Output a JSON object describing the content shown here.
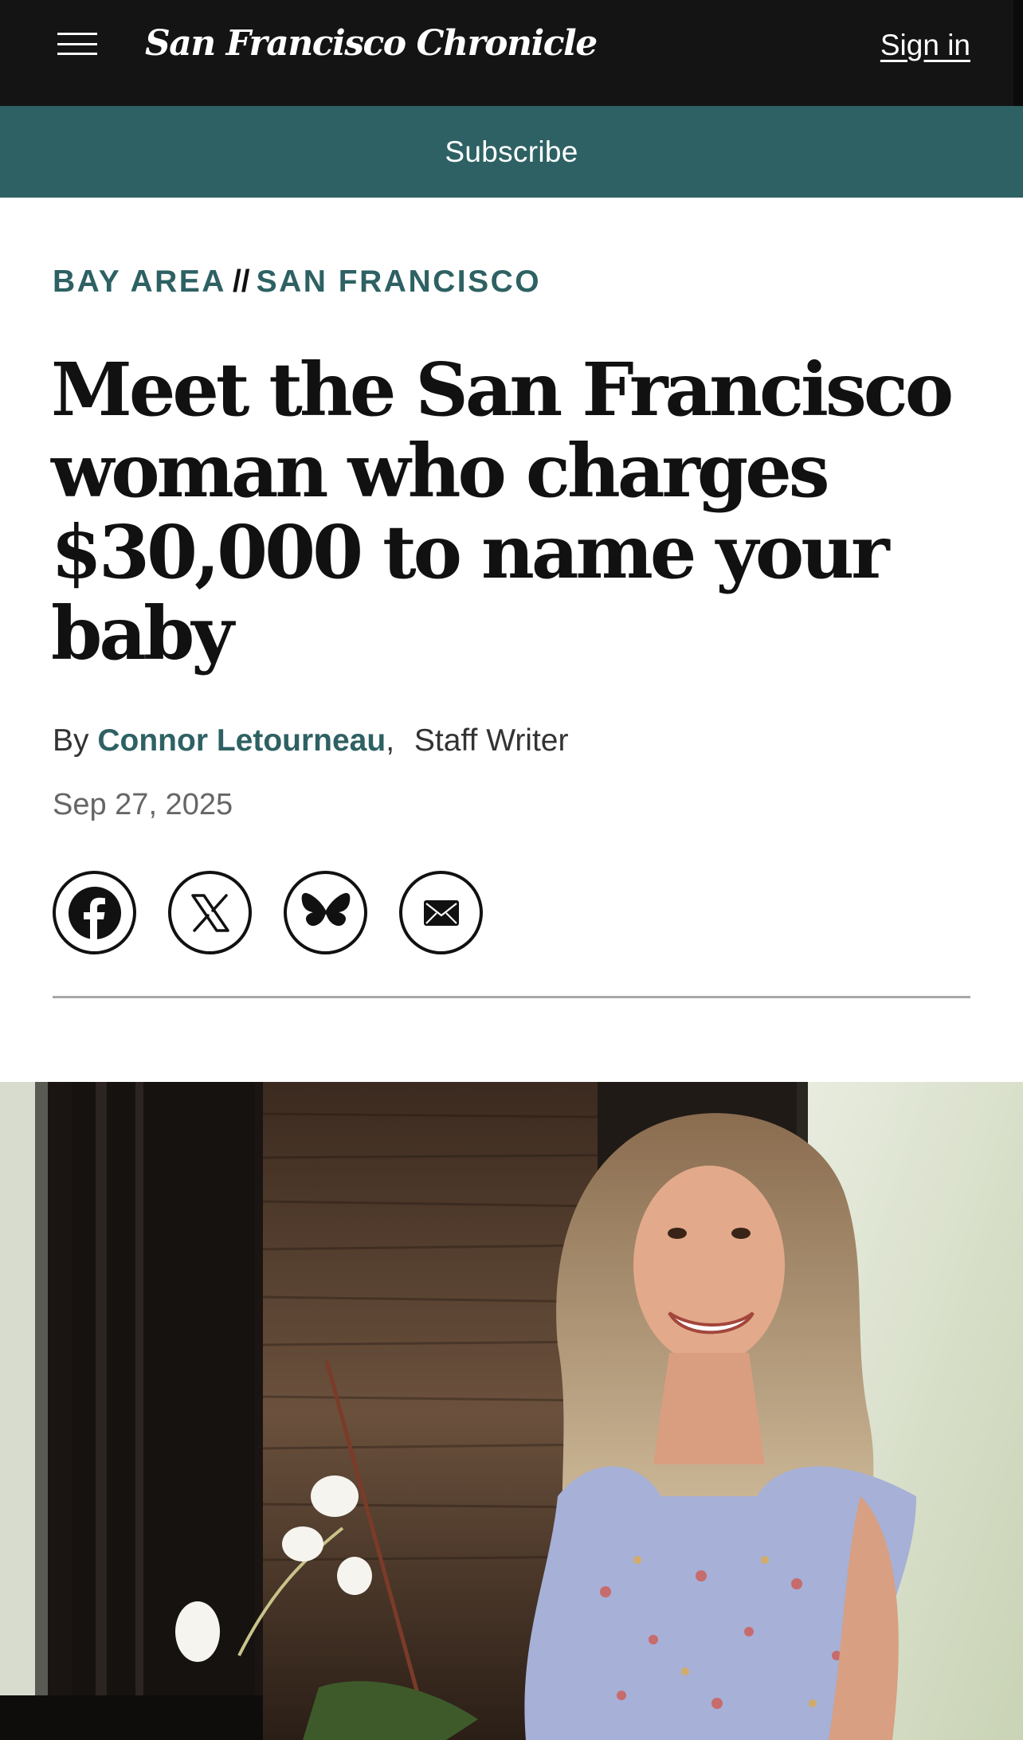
{
  "header": {
    "logo_text": "San Francisco Chronicle",
    "signin_label": "Sign in",
    "menu_icon": "hamburger-menu-icon"
  },
  "subscribe": {
    "label": "Subscribe"
  },
  "article": {
    "breadcrumb": {
      "section": "BAY AREA",
      "separator": "//",
      "subsection": "SAN FRANCISCO"
    },
    "headline": "Meet the San Francisco woman who charges $30,000 to name your baby",
    "byline": {
      "prefix": "By",
      "author": "Connor Letourneau",
      "comma": ",",
      "role": "Staff Writer"
    },
    "date": "Sep 27, 2025",
    "share": [
      {
        "name": "facebook-share-button",
        "icon": "facebook-icon"
      },
      {
        "name": "x-share-button",
        "icon": "x-icon"
      },
      {
        "name": "bluesky-share-button",
        "icon": "bluesky-butterfly-icon"
      },
      {
        "name": "email-share-button",
        "icon": "envelope-icon"
      }
    ]
  },
  "colors": {
    "header_bg": "#141414",
    "brand_teal": "#2e6163",
    "text": "#111111",
    "muted": "#666666"
  }
}
